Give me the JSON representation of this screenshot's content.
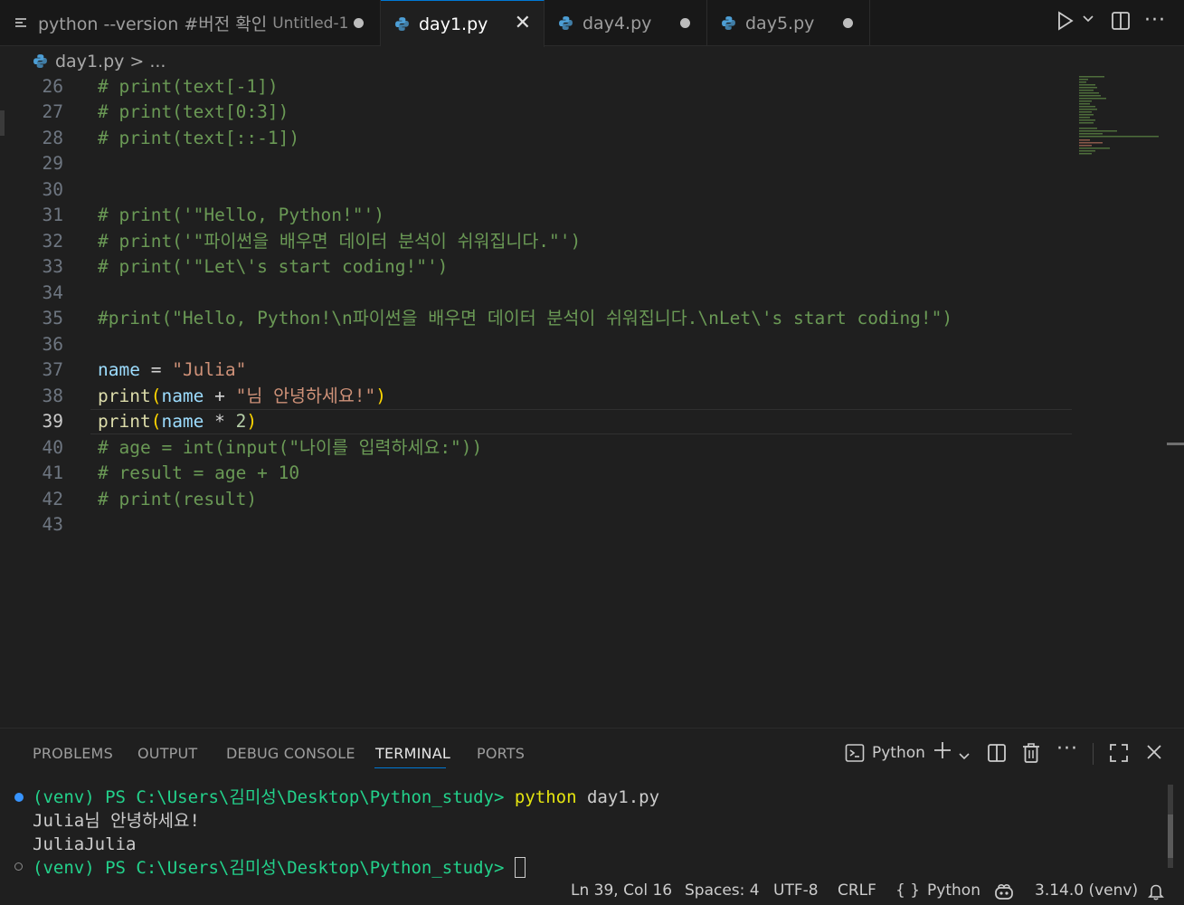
{
  "tabs": [
    {
      "label": "python --version #버전 확인",
      "sub": "Untitled-1",
      "state": "modified"
    },
    {
      "label": "day1.py",
      "state": "active"
    },
    {
      "label": "day4.py",
      "state": "modified"
    },
    {
      "label": "day5.py",
      "state": "modified"
    }
  ],
  "breadcrumb": {
    "file": "day1.py",
    "rest": "> ..."
  },
  "editor": {
    "lines": [
      {
        "n": "26"
      },
      {
        "n": "27"
      },
      {
        "n": "28"
      },
      {
        "n": "29"
      },
      {
        "n": "30"
      },
      {
        "n": "31"
      },
      {
        "n": "32"
      },
      {
        "n": "33"
      },
      {
        "n": "34"
      },
      {
        "n": "35"
      },
      {
        "n": "36"
      },
      {
        "n": "37"
      },
      {
        "n": "38"
      },
      {
        "n": "39"
      },
      {
        "n": "40"
      },
      {
        "n": "41"
      },
      {
        "n": "42"
      },
      {
        "n": "43"
      }
    ],
    "code": {
      "l26": "# print(text[-1])",
      "l27": "# print(text[0:3])",
      "l28": "# print(text[::-1])",
      "l31": "# print('\"Hello, Python!\"')",
      "l32": "# print('\"파이썬을 배우면 데이터 분석이 쉬워집니다.\"')",
      "l33": "# print('\"Let\\'s start coding!\"')",
      "l35": "#print(\"Hello, Python!\\n파이썬을 배우면 데이터 분석이 쉬워집니다.\\nLet\\'s start coding!\")",
      "l37": {
        "var": "name",
        "eq": " = ",
        "str": "\"Julia\""
      },
      "l38": {
        "fn": "print",
        "open": "(",
        "var": "name",
        "op": " + ",
        "str": "\"님 안녕하세요!\"",
        "close": ")"
      },
      "l39": {
        "fn": "print",
        "open": "(",
        "var": "name",
        "op": " * ",
        "num": "2",
        "close": ")"
      },
      "l40": "# age = int(input(\"나이를 입력하세요:\"))",
      "l41": "# result = age + 10",
      "l42": "# print(result)"
    }
  },
  "panel": {
    "tabs": [
      "PROBLEMS",
      "OUTPUT",
      "DEBUG CONSOLE",
      "TERMINAL",
      "PORTS"
    ],
    "active_tab": "TERMINAL",
    "shell_label": "Python",
    "terminal": {
      "prompt1": "(venv) PS C:\\Users\\김미성\\Desktop\\Python_study>",
      "cmd": "python",
      "cmd_arg": " day1.py",
      "out1": "Julia님 안녕하세요!",
      "out2": "JuliaJulia",
      "prompt2": "(venv) PS C:\\Users\\김미성\\Desktop\\Python_study>"
    }
  },
  "statusbar": {
    "position": "Ln 39, Col 16",
    "spaces": "Spaces: 4",
    "encoding": "UTF-8",
    "eol": "CRLF",
    "language": "Python",
    "interpreter": "3.14.0 (venv)"
  },
  "colors": {
    "accent": "#0078d4",
    "comment": "#6a9955",
    "string": "#ce9178",
    "variable": "#9cdcfe",
    "function": "#dcdcaa"
  }
}
